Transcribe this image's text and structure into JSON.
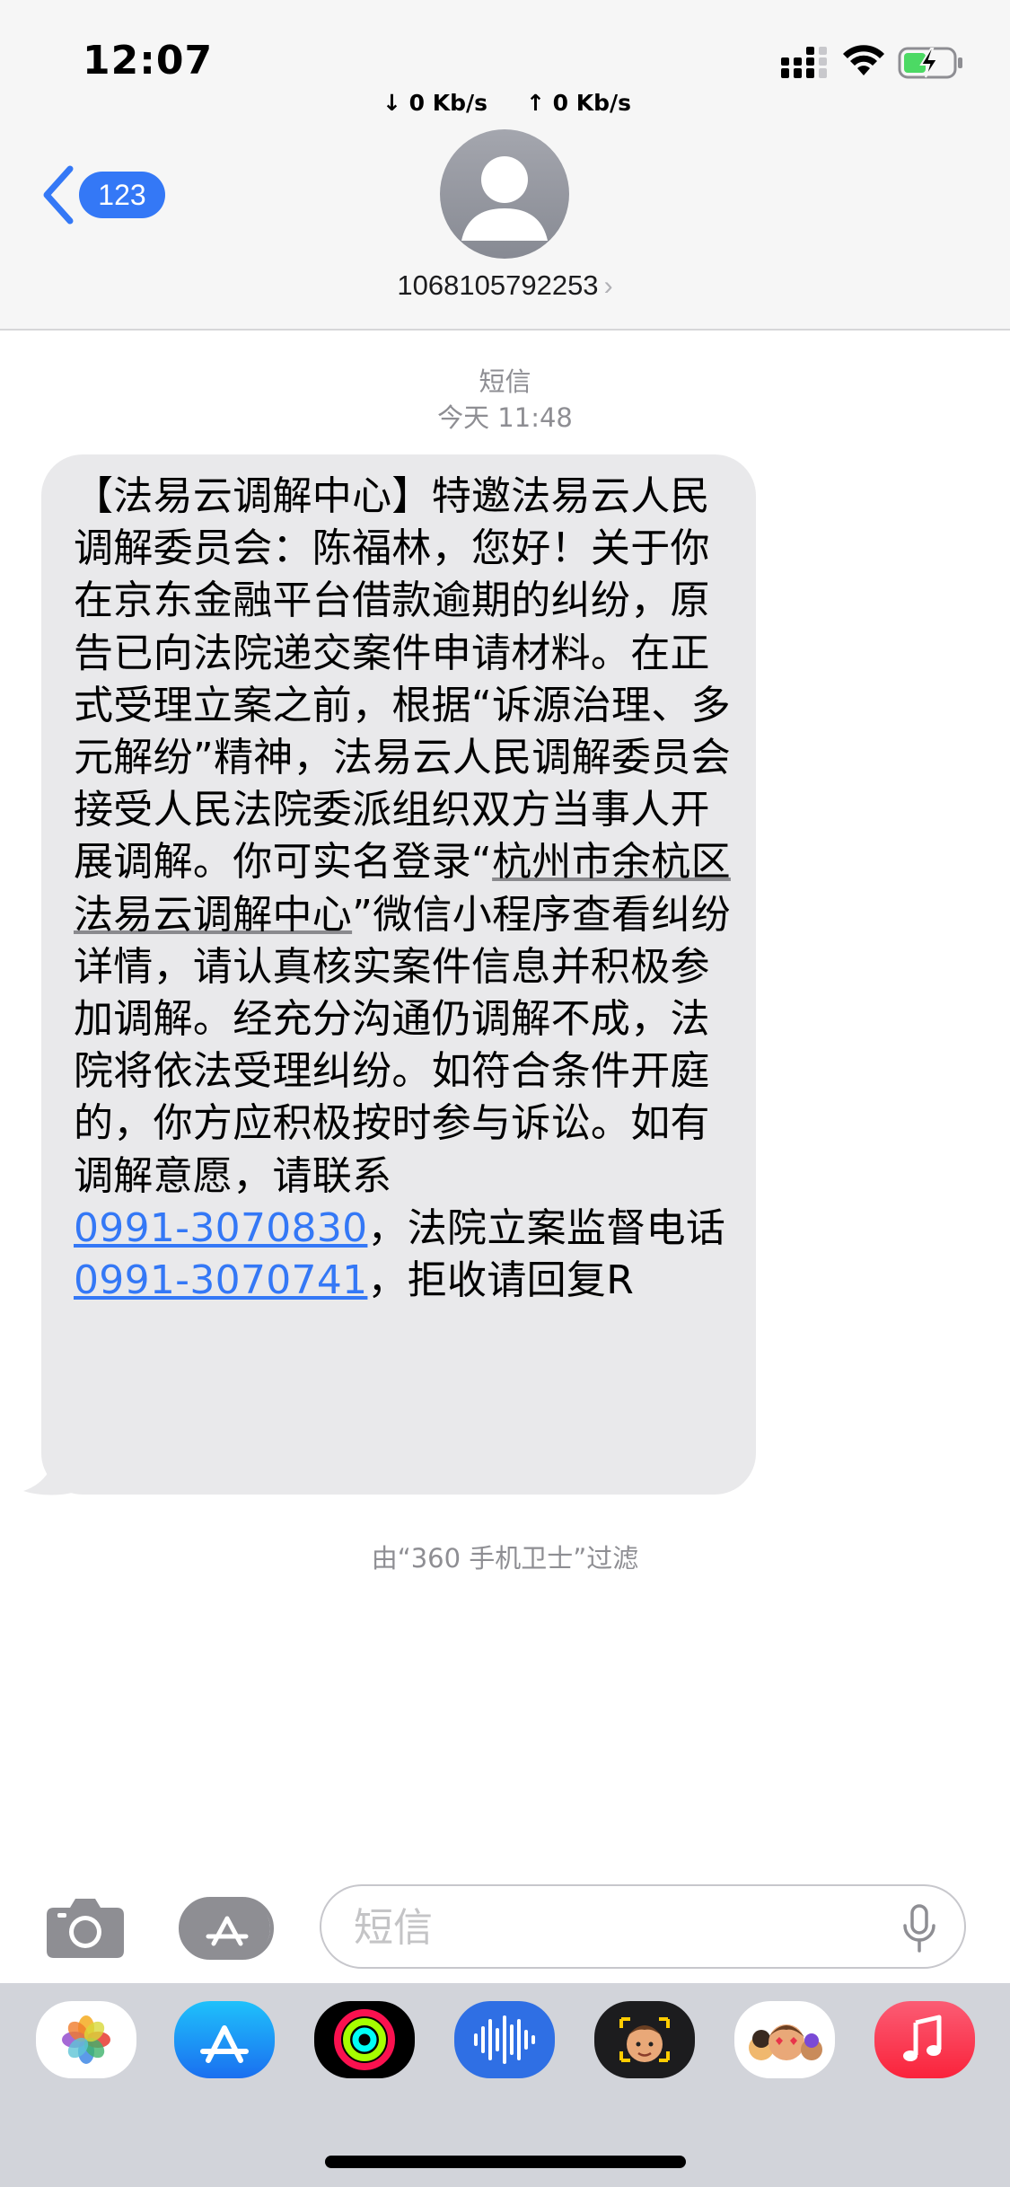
{
  "status_bar": {
    "time": "12:07",
    "net_down": "↓ 0 Kb/s",
    "net_up": "↑ 0 Kb/s",
    "icons": [
      "signal-icon",
      "wifi-icon",
      "battery-charging-icon"
    ]
  },
  "header": {
    "back_badge": "123",
    "contact_number": "1068105792253",
    "avatar_icon": "person-silhouette-icon"
  },
  "conversation": {
    "service_label": "短信",
    "timestamp": "今天 11:48",
    "message": {
      "part1": "【法易云调解中心】特邀法易云人民调解委员会：陈福林，您好！关于你在京东金融平台借款逾期的纠纷，原告已向法院递交案件申请材料。在正式受理立案之前，根据“诉源治理、多元解纷”精神，法易云人民调解委员会接受人民法院委派组织双方当事人开展调解。你可实名登录“",
      "underlined": "杭州市余杭区法易云调解中心",
      "part2": "”微信小程序查看纠纷详情，请认真核实案件信息并积极参加调解。经充分沟通仍调解不成，法院将依法受理纠纷。如符合条件开庭的，你方应积极按时参与诉讼。如有调解意愿，请联系",
      "phone1": "0991-3070830",
      "part3": "，法院立案监督电话",
      "phone2": "0991-3070741",
      "part4": "，拒收请回复R"
    },
    "filter_note": "由“360 手机卫士”过滤"
  },
  "input_bar": {
    "placeholder": "短信",
    "icons": [
      "camera-icon",
      "app-store-icon",
      "mic-icon"
    ]
  },
  "app_drawer": {
    "apps": [
      "photos-app-icon",
      "app-store-app-icon",
      "fitness-app-icon",
      "audio-app-icon",
      "memoji-app-icon",
      "memoji-stickers-app-icon",
      "music-app-icon"
    ]
  },
  "colors": {
    "accent": "#3478f6",
    "bubble": "#e9e9eb",
    "header_bg": "#f6f6f6",
    "drawer_bg": "#d2d4da",
    "secondary_text": "#8e8e93"
  }
}
